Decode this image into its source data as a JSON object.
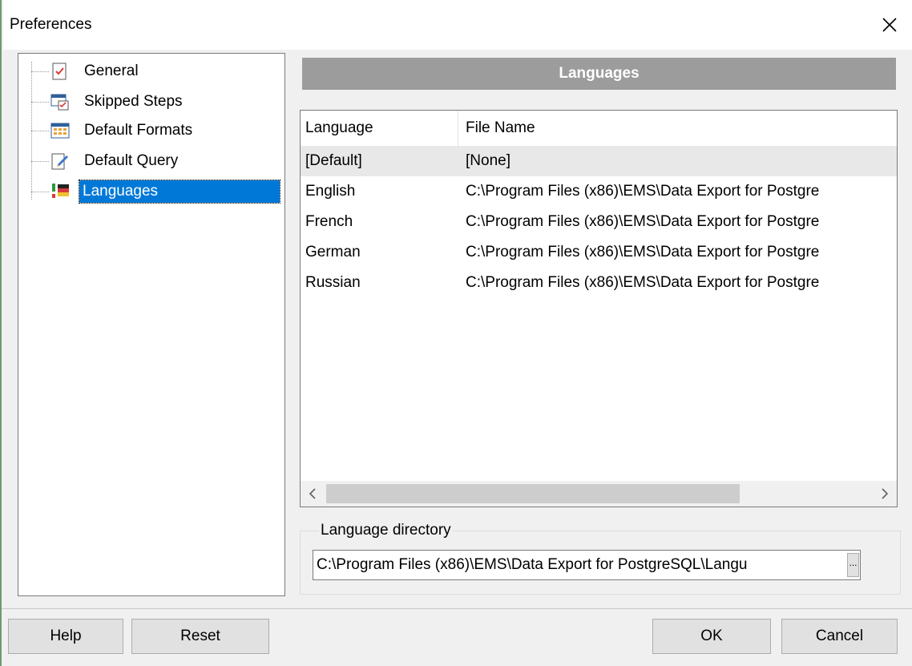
{
  "window": {
    "title": "Preferences"
  },
  "tree": {
    "items": [
      {
        "label": "General",
        "icon": "general-icon"
      },
      {
        "label": "Skipped Steps",
        "icon": "skipped-steps-icon"
      },
      {
        "label": "Default Formats",
        "icon": "default-formats-icon"
      },
      {
        "label": "Default Query",
        "icon": "default-query-icon"
      },
      {
        "label": "Languages",
        "icon": "languages-icon",
        "selected": true
      }
    ]
  },
  "panel": {
    "header": "Languages"
  },
  "grid": {
    "columns": [
      "Language",
      "File Name"
    ],
    "rows": [
      {
        "language": "[Default]",
        "file": "[None]"
      },
      {
        "language": "English",
        "file": "C:\\Program Files (x86)\\EMS\\Data Export for Postgre"
      },
      {
        "language": "French",
        "file": "C:\\Program Files (x86)\\EMS\\Data Export for Postgre"
      },
      {
        "language": "German",
        "file": "C:\\Program Files (x86)\\EMS\\Data Export for Postgre"
      },
      {
        "language": "Russian",
        "file": "C:\\Program Files (x86)\\EMS\\Data Export for Postgre"
      }
    ]
  },
  "language_directory": {
    "label": "Language directory",
    "value": "C:\\Program Files (x86)\\EMS\\Data Export for PostgreSQL\\Langu",
    "browse_label": "..."
  },
  "buttons": {
    "help": "Help",
    "reset": "Reset",
    "ok": "OK",
    "cancel": "Cancel"
  },
  "colors": {
    "selection": "#0078d7",
    "header_bar": "#9c9c9c"
  }
}
